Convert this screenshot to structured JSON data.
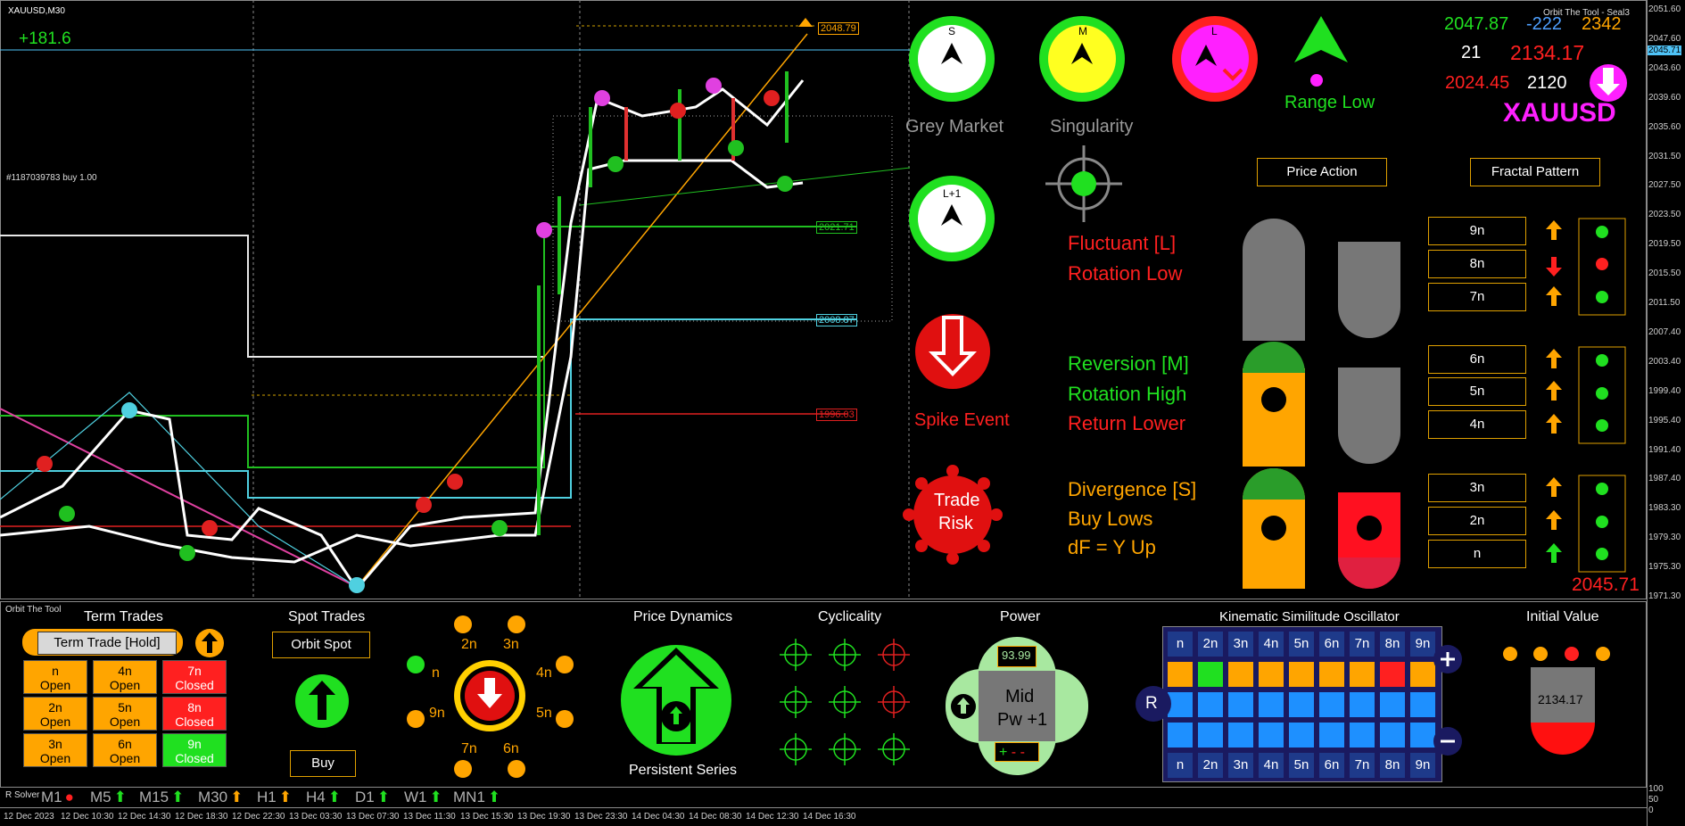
{
  "window": {
    "symbol_title": "XAUUSD,M30",
    "profit": "+181.6",
    "order_label": "#1187039783 buy 1.00",
    "indicator_name": "Orbit The Tool - Seal3"
  },
  "price_lines": {
    "top": "2048.79",
    "mid1": "2021.71",
    "mid2": "2008.87",
    "low": "1996.03",
    "current": "2045.71"
  },
  "price_scale": [
    "2051.60",
    "2047.60",
    "2043.60",
    "2039.60",
    "2035.60",
    "2031.50",
    "2027.50",
    "2023.50",
    "2019.50",
    "2015.50",
    "2011.50",
    "2007.40",
    "2003.40",
    "1999.40",
    "1995.40",
    "1991.40",
    "1987.40",
    "1983.30",
    "1979.30",
    "1975.30",
    "1971.30"
  ],
  "sub_scale": [
    "100",
    "50",
    "0"
  ],
  "time_axis": [
    "12 Dec 2023",
    "12 Dec 10:30",
    "12 Dec 14:30",
    "12 Dec 18:30",
    "12 Dec 22:30",
    "13 Dec 03:30",
    "13 Dec 07:30",
    "13 Dec 11:30",
    "13 Dec 15:30",
    "13 Dec 19:30",
    "13 Dec 23:30",
    "14 Dec 04:30",
    "14 Dec 08:30",
    "14 Dec 12:30",
    "14 Dec 16:30"
  ],
  "compass": {
    "s_label": "S",
    "m_label": "M",
    "l_label": "L",
    "l1_label": "L+1",
    "grey_market": "Grey Market",
    "singularity": "Singularity",
    "range_low": "Range Low",
    "spike_event": "Spike Event",
    "trade_risk_1": "Trade",
    "trade_risk_2": "Risk"
  },
  "stats": {
    "a": "2047.87",
    "b": "-222",
    "c": "2342",
    "d": "21",
    "e": "2134.17",
    "f": "2024.45",
    "g": "2120",
    "symbol": "XAUUSD",
    "big_price": "2045.71"
  },
  "pattern": {
    "price_action": "Price Action",
    "fractal_pattern": "Fractal Pattern",
    "rows": [
      "9n",
      "8n",
      "7n",
      "6n",
      "5n",
      "4n",
      "3n",
      "2n",
      "n"
    ],
    "arrows": [
      "up-orange",
      "down-red",
      "up-orange",
      "up-orange",
      "up-orange",
      "up-orange",
      "up-orange",
      "up-orange",
      "up-green"
    ]
  },
  "states": {
    "l_title": "Fluctuant [L]",
    "l_sub": "Rotation Low",
    "m_title": "Reversion [M]",
    "m_sub1": "Rotation High",
    "m_sub2": "Return Lower",
    "s_title": "Divergence [S]",
    "s_sub1": "Buy Lows",
    "s_sub2": "dF = Y Up"
  },
  "bottom": {
    "orbit_tool": "Orbit The Tool",
    "r_solver": "R Solver",
    "term_trades": "Term Trades",
    "term_trade_hold": "Term Trade [Hold]",
    "term_cells": [
      {
        "n": "n",
        "s": "Open",
        "c": "#ffa500"
      },
      {
        "n": "4n",
        "s": "Open",
        "c": "#ffa500"
      },
      {
        "n": "7n",
        "s": "Closed",
        "c": "#ff2020"
      },
      {
        "n": "2n",
        "s": "Open",
        "c": "#ffa500"
      },
      {
        "n": "5n",
        "s": "Open",
        "c": "#ffa500"
      },
      {
        "n": "8n",
        "s": "Closed",
        "c": "#ff2020"
      },
      {
        "n": "3n",
        "s": "Open",
        "c": "#ffa500"
      },
      {
        "n": "6n",
        "s": "Open",
        "c": "#ffa500"
      },
      {
        "n": "9n",
        "s": "Closed",
        "c": "#20e020"
      }
    ],
    "spot_trades": "Spot Trades",
    "orbit_spot": "Orbit Spot",
    "buy": "Buy",
    "ring_labels": [
      "n",
      "2n",
      "3n",
      "4n",
      "5n",
      "6n",
      "7n",
      "9n"
    ],
    "price_dynamics": "Price Dynamics",
    "persistent_series": "Persistent Series",
    "cyclicality": "Cyclicality",
    "power": "Power",
    "power_value": "93.99",
    "power_mid": "Mid",
    "power_pw": "Pw +1",
    "kso": "Kinematic Similitude Oscillator",
    "kso_head": [
      "n",
      "2n",
      "3n",
      "4n",
      "5n",
      "6n",
      "7n",
      "8n",
      "9n"
    ],
    "initial_value": "Initial Value",
    "initial_price": "2134.17",
    "timeframes": [
      "M1",
      "M5",
      "M15",
      "M30",
      "H1",
      "H4",
      "D1",
      "W1",
      "MN1"
    ]
  }
}
